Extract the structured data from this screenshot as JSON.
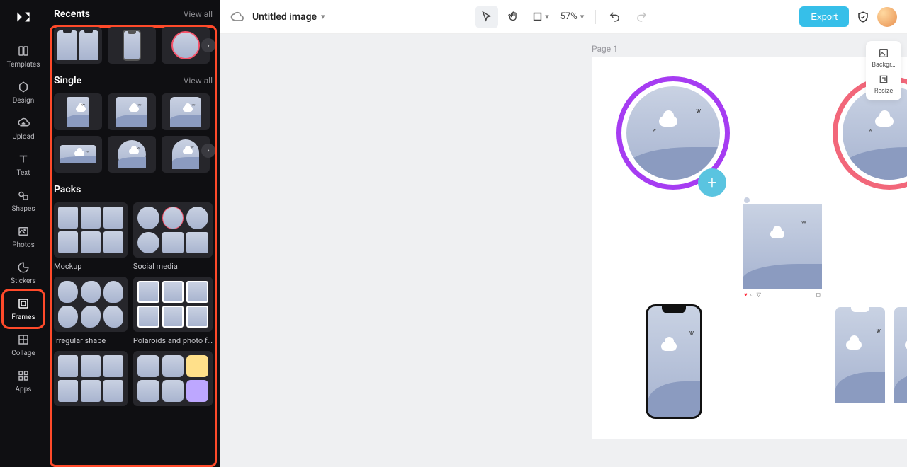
{
  "rail": {
    "items": [
      {
        "label": "Templates"
      },
      {
        "label": "Design"
      },
      {
        "label": "Upload"
      },
      {
        "label": "Text"
      },
      {
        "label": "Shapes"
      },
      {
        "label": "Photos"
      },
      {
        "label": "Stickers"
      },
      {
        "label": "Frames"
      },
      {
        "label": "Collage"
      },
      {
        "label": "Apps"
      }
    ]
  },
  "panel": {
    "recents": {
      "title": "Recents",
      "viewall": "View all"
    },
    "single": {
      "title": "Single",
      "viewall": "View all"
    },
    "packs": {
      "title": "Packs",
      "items": [
        {
          "label": "Mockup"
        },
        {
          "label": "Social media"
        },
        {
          "label": "Irregular shape"
        },
        {
          "label": "Polaroids and photo f…"
        }
      ]
    }
  },
  "topbar": {
    "title": "Untitled image",
    "zoom": "57%",
    "export": "Export"
  },
  "canvas": {
    "page_label": "Page 1"
  },
  "right_tools": {
    "background": "Backgr…",
    "resize": "Resize"
  }
}
